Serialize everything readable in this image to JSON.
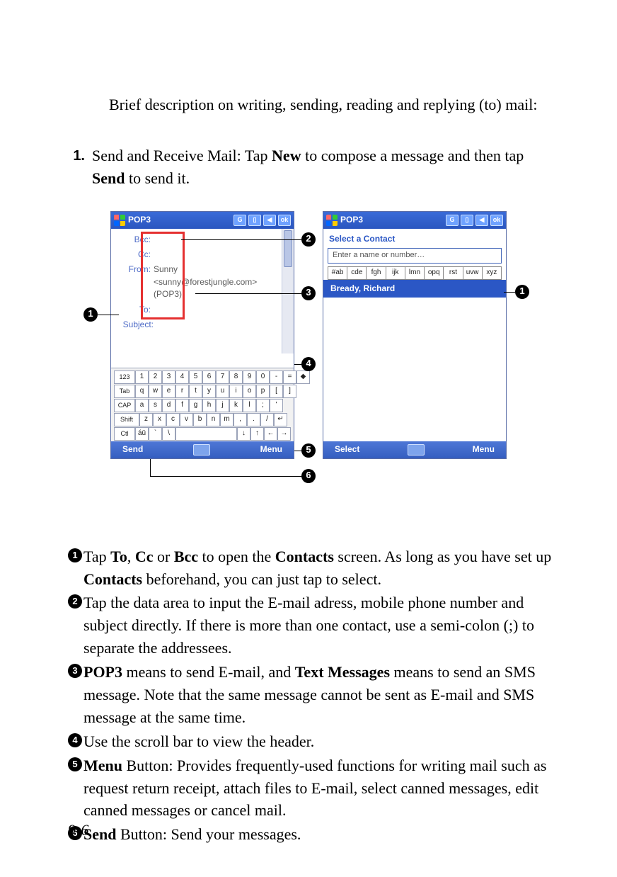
{
  "intro": "Brief description on writing, sending, reading and replying (to) mail:",
  "step": {
    "num": "1.",
    "pre": "Send and Receive Mail: Tap ",
    "bold1": "New",
    "mid": " to compose a message and then tap ",
    "bold2": "Send",
    "post": " to send it."
  },
  "left": {
    "title": "POP3",
    "ok": "ok",
    "labels": {
      "bcc": "Bcc:",
      "cc": "Cc:",
      "from": "From:",
      "to": "To:",
      "subject": "Subject:"
    },
    "from_name": "Sunny",
    "from_addr": "<sunny@forestjungle.com>",
    "account": "(POP3)",
    "kb": {
      "row1_first": "123",
      "row1": [
        "1",
        "2",
        "3",
        "4",
        "5",
        "6",
        "7",
        "8",
        "9",
        "0",
        "-",
        "=",
        "◆"
      ],
      "row2_first": "Tab",
      "row2": [
        "q",
        "w",
        "e",
        "r",
        "t",
        "y",
        "u",
        "i",
        "o",
        "p",
        "[",
        "]"
      ],
      "row3_first": "CAP",
      "row3": [
        "a",
        "s",
        "d",
        "f",
        "g",
        "h",
        "j",
        "k",
        "l",
        ";",
        "'"
      ],
      "row4_first": "Shift",
      "row4": [
        "z",
        "x",
        "c",
        "v",
        "b",
        "n",
        "m",
        ",",
        ".",
        "/",
        "↵"
      ],
      "row5_first": "Ctl",
      "row5_second": "áü",
      "row5_rest": [
        "`",
        "\\"
      ],
      "arrows": [
        "↓",
        "↑",
        "←",
        "→"
      ]
    },
    "send": "Send",
    "menu": "Menu"
  },
  "right": {
    "title": "POP3",
    "ok": "ok",
    "select_contact": "Select a Contact",
    "placeholder": "Enter a name or number…",
    "alpha": [
      "#ab",
      "cde",
      "fgh",
      "ijk",
      "lmn",
      "opq",
      "rst",
      "uvw",
      "xyz"
    ],
    "hit": "Bready, Richard",
    "select": "Select",
    "menu": "Menu"
  },
  "callouts": {
    "c1": "1",
    "c2": "2",
    "c3": "3",
    "c4": "4",
    "c5": "5",
    "c6": "6"
  },
  "legend": {
    "l1": {
      "pre": "Tap ",
      "b1": "To",
      "t1": ", ",
      "b2": "Cc",
      "t2": " or ",
      "b3": "Bcc",
      "t3": " to open the ",
      "b4": "Contacts",
      "t4": " screen. As long as you have set up ",
      "b5": "Contacts",
      "t5": " beforehand, you can just tap to select."
    },
    "l2": "Tap the data area to input the E-mail adress, mobile phone number and subject directly. If there is more than one contact, use a semi-colon (;) to separate the addressees.",
    "l3": {
      "b1": "POP3",
      "t1": " means to send E-mail, and ",
      "b2": "Text Messages",
      "t2": " means to send an SMS message. Note that the same message cannot be sent as E-mail and SMS message at the same time."
    },
    "l4": "Use the scroll bar to view the header.",
    "l5": {
      "b1": "Menu",
      "t1": " Button: Provides frequently-used functions for writing mail such as request return receipt, attach files to E-mail, select canned messages, edit canned messages or cancel mail."
    },
    "l6": {
      "b1": "Send",
      "t1": " Button: Send your messages."
    }
  },
  "page_num": "9-6"
}
